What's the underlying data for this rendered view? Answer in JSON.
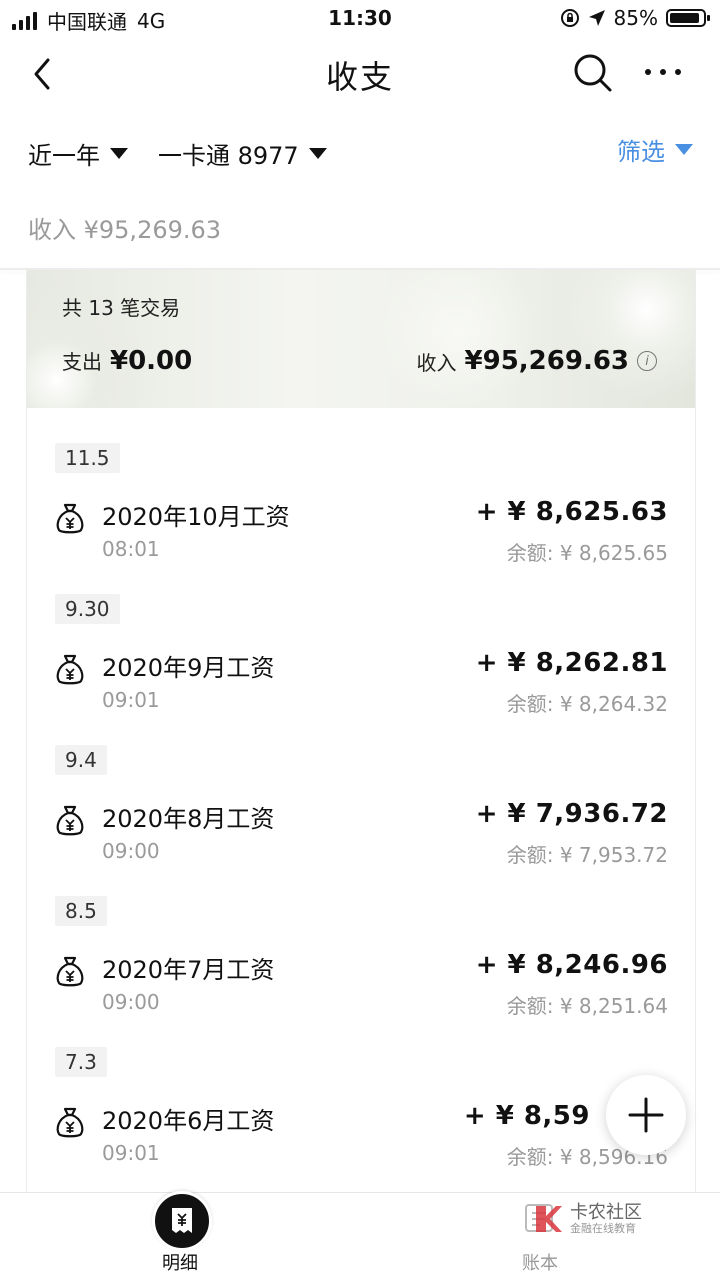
{
  "status": {
    "carrier": "中国联通",
    "network": "4G",
    "time": "11:30",
    "battery": "85%"
  },
  "nav": {
    "title": "收支"
  },
  "filters": {
    "period": "近一年",
    "card": "一卡通 8977",
    "filter": "筛选"
  },
  "summary": {
    "income_label": "收入 ¥95,269.63"
  },
  "banner": {
    "count": "共 13 笔交易",
    "expense_label": "支出",
    "expense_amount": "¥0.00",
    "income_label": "收入",
    "income_amount": "¥95,269.63"
  },
  "transactions": [
    {
      "date": "11.5",
      "name": "2020年10月工资",
      "time": "08:01",
      "amount": "+ ¥ 8,625.63",
      "balance": "余额: ¥ 8,625.65"
    },
    {
      "date": "9.30",
      "name": "2020年9月工资",
      "time": "09:01",
      "amount": "+ ¥ 8,262.81",
      "balance": "余额: ¥ 8,264.32"
    },
    {
      "date": "9.4",
      "name": "2020年8月工资",
      "time": "09:00",
      "amount": "+ ¥ 7,936.72",
      "balance": "余额: ¥ 7,953.72"
    },
    {
      "date": "8.5",
      "name": "2020年7月工资",
      "time": "09:00",
      "amount": "+ ¥ 8,246.96",
      "balance": "余额: ¥ 8,251.64"
    },
    {
      "date": "7.3",
      "name": "2020年6月工资",
      "time": "09:01",
      "amount": "+ ¥ 8,59",
      "balance": "余额: ¥ 8,596.16"
    }
  ],
  "tabs": {
    "detail": "明细",
    "ledger": "账本"
  },
  "watermark": {
    "main": "卡农社区",
    "sub": "金融在线教育"
  }
}
